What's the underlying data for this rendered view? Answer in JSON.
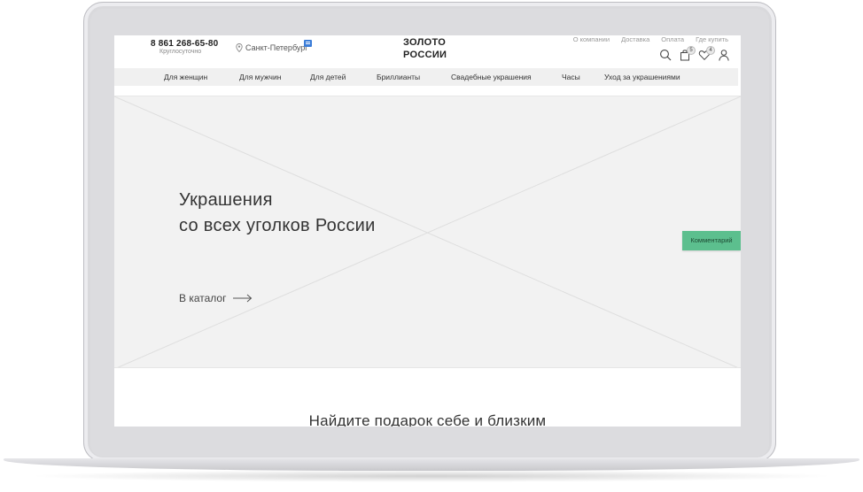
{
  "header": {
    "phone": "8 861 268-65-80",
    "phone_note": "Круглосуточно",
    "city": "Санкт-Петербург",
    "logo_line1": "ЗОЛОТО",
    "logo_line2": "РОССИИ",
    "top_links": [
      "О компании",
      "Доставка",
      "Оплата",
      "Где купить"
    ],
    "icons": {
      "search": "search-icon",
      "cart": "bag-icon",
      "favorites": "heart-icon",
      "account": "user-icon"
    },
    "cart_count": "5",
    "favorites_count": "4"
  },
  "nav": {
    "items": [
      "Для женщин",
      "Для мужчин",
      "Для детей",
      "Бриллианты",
      "Свадебные украшения",
      "Часы",
      "Уход за украшениями"
    ]
  },
  "hero": {
    "title_line1": "Украшения",
    "title_line2": "со всех уголков России",
    "link": "В каталог"
  },
  "comment_button": "Комментарий",
  "section_title": "Найдите подарок себе и близким",
  "colors": {
    "accent": "#5cbf8e",
    "hero_bg": "#f2f2f2",
    "nav_bg": "#f0f0f0"
  }
}
